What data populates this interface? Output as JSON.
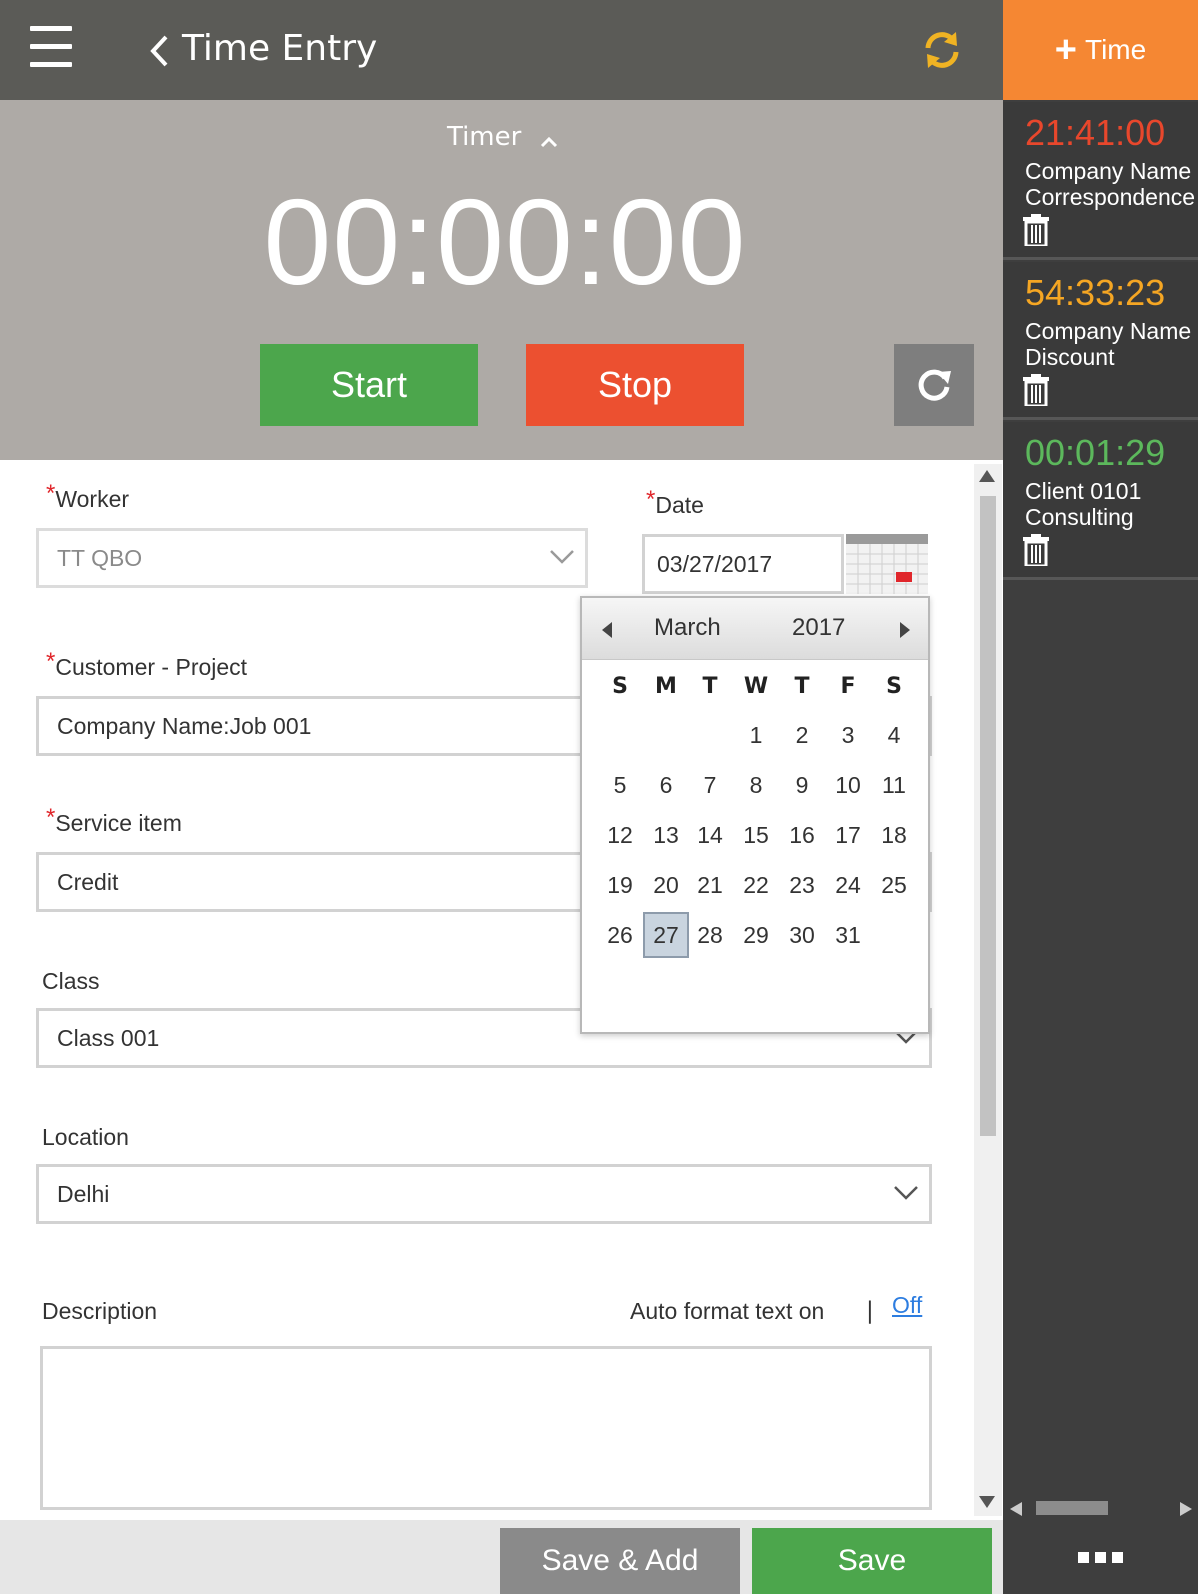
{
  "header": {
    "title": "Time Entry",
    "menu_icon": "hamburger-icon",
    "back_icon": "chevron-left-icon",
    "sync_icon": "sync-icon"
  },
  "timer": {
    "label": "Timer",
    "display": "00:00:00",
    "start_label": "Start",
    "stop_label": "Stop",
    "reset_icon": "reset-icon"
  },
  "form": {
    "worker": {
      "label": "Worker",
      "value": "TT QBO"
    },
    "date": {
      "label": "Date",
      "value": "03/27/2017"
    },
    "customer": {
      "label": "Customer - Project",
      "value": "Company  Name:Job 001"
    },
    "service": {
      "label": "Service item",
      "value": "Credit"
    },
    "class": {
      "label": "Class",
      "value": "Class 001"
    },
    "location": {
      "label": "Location",
      "value": "Delhi"
    },
    "description": {
      "label": "Description",
      "value": ""
    },
    "auto_format_label": "Auto format text on",
    "separator": "|",
    "off_link": "Off",
    "required_mark": "*"
  },
  "datepicker": {
    "month": "March",
    "year": "2017",
    "weekdays": [
      "S",
      "M",
      "T",
      "W",
      "T",
      "F",
      "S"
    ],
    "days": [
      "1",
      "2",
      "3",
      "4",
      "5",
      "6",
      "7",
      "8",
      "9",
      "10",
      "11",
      "12",
      "13",
      "14",
      "15",
      "16",
      "17",
      "18",
      "19",
      "20",
      "21",
      "22",
      "23",
      "24",
      "25",
      "26",
      "27",
      "28",
      "29",
      "30",
      "31"
    ],
    "selected_day": "27"
  },
  "sidebar": {
    "add_time_label": "Time",
    "entries": [
      {
        "time": "21:41:00",
        "customer": "Company  Name",
        "item": "Correspondence",
        "color": "#e8472c"
      },
      {
        "time": "54:33:23",
        "customer": "Company  Name",
        "item": "Discount",
        "color": "#f5a623"
      },
      {
        "time": "00:01:29",
        "customer": "Client 0101",
        "item": "Consulting",
        "color": "#5cb85c"
      }
    ]
  },
  "footer": {
    "save_add_label": "Save & Add",
    "save_label": "Save",
    "more_icon": "more-icon"
  },
  "colors": {
    "header": "#5b5b57",
    "timer_panel": "#aeaaa6",
    "start": "#4ca64c",
    "stop": "#ec5030",
    "add_time": "#f58733",
    "required": "#e0262b",
    "link": "#2d7de0"
  }
}
